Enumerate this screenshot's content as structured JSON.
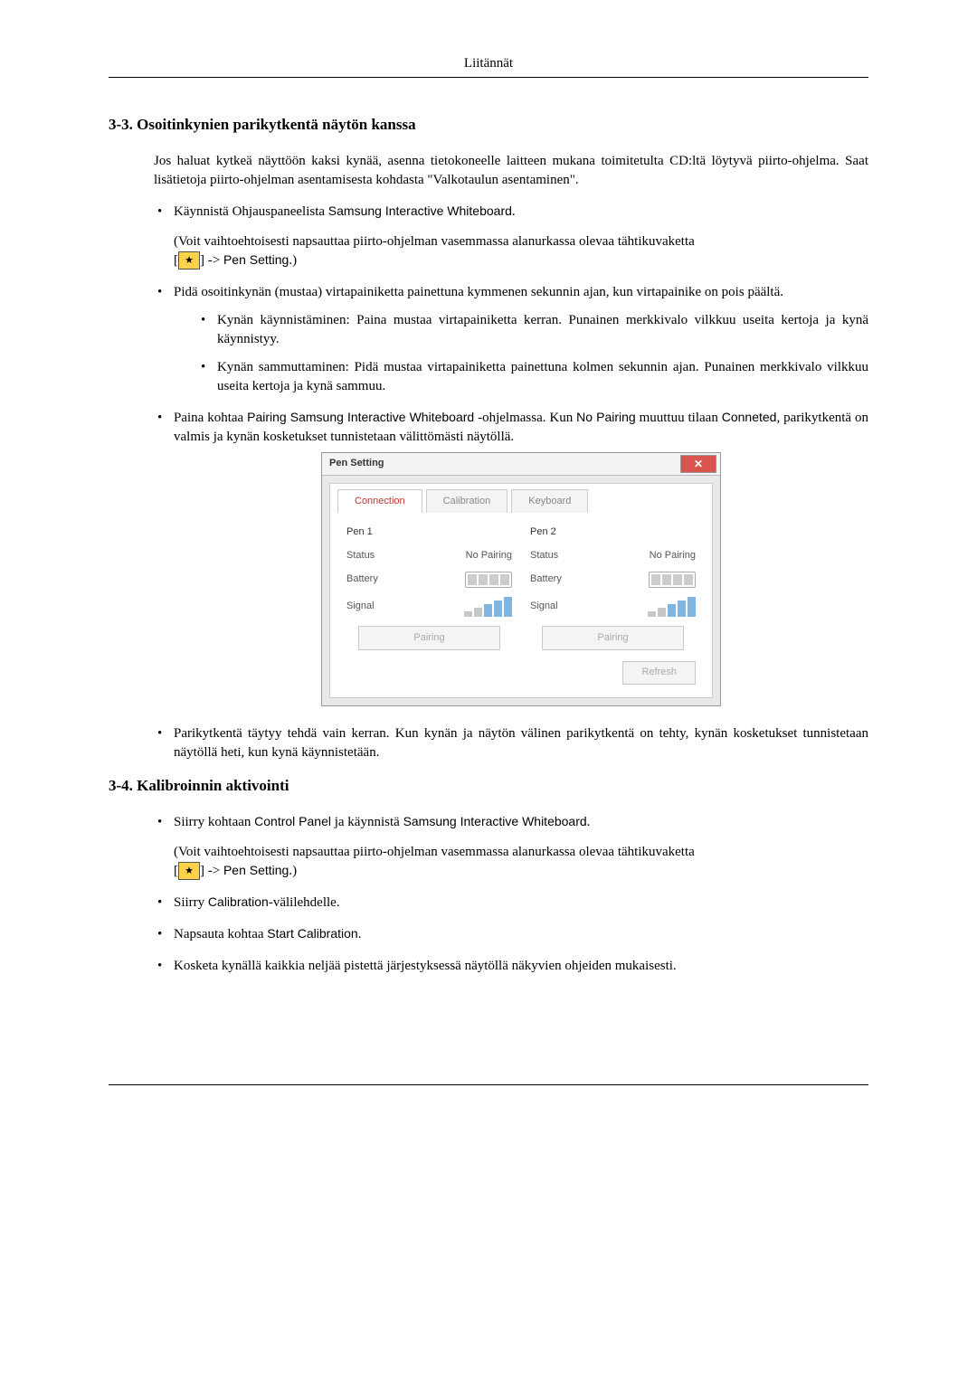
{
  "header": {
    "title": "Liitännät"
  },
  "section33": {
    "heading": "3-3. Osoitinkynien parikytkentä näytön kanssa",
    "intro": "Jos haluat kytkeä näyttöön kaksi kynää, asenna tietokoneelle laitteen mukana toimitetulta CD:ltä löytyvä piirto-ohjelma. Saat lisätietoja piirto-ohjelman asentamisesta kohdasta \"Valkotaulun asentaminen\".",
    "b1_pre": "Käynnistä Ohjauspaneelista ",
    "b1_sans": "Samsung Interactive Whiteboard",
    "b1_post": ".",
    "b1_alt_pre": "(Voit vaihtoehtoisesti napsauttaa piirto-ohjelman vasemmassa alanurkassa olevaa tähtikuvaketta",
    "b1_alt_arrow": "] -> ",
    "b1_alt_sans": "Pen Setting",
    "b1_alt_post": ".)",
    "b2": "Pidä osoitinkynän (mustaa) virtapainiketta painettuna kymmenen sekunnin ajan, kun virtapainike on pois päältä.",
    "b2s1": "Kynän käynnistäminen: Paina mustaa virtapainiketta kerran. Punainen merkkivalo vilkkuu useita kertoja ja kynä käynnistyy.",
    "b2s2": "Kynän sammuttaminen: Pidä mustaa virtapainiketta painettuna kolmen sekunnin ajan. Punainen merkkivalo vilkkuu useita kertoja ja kynä sammuu.",
    "b3_pre": "Paina kohtaa ",
    "b3_sans1": "Pairing Samsung Interactive Whiteboard",
    "b3_mid": " -ohjelmassa. Kun ",
    "b3_sans2": "No Pairing",
    "b3_mid2": " muuttuu tilaan ",
    "b3_sans3": "Conneted",
    "b3_post": ", parikytkentä on valmis ja kynän kosketukset tunnistetaan välittömästi näytöllä.",
    "b4": "Parikytkentä täytyy tehdä vain kerran. Kun kynän ja näytön välinen parikytkentä on tehty, kynän kosketukset tunnistetaan näytöllä heti, kun kynä käynnistetään."
  },
  "dialog": {
    "title": "Pen Setting",
    "tabs": {
      "connection": "Connection",
      "calibration": "Calibration",
      "keyboard": "Keyboard"
    },
    "pen1": "Pen 1",
    "pen2": "Pen 2",
    "statusLabel": "Status",
    "statusValue": "No Pairing",
    "batteryLabel": "Battery",
    "signalLabel": "Signal",
    "pairingBtn": "Pairing",
    "refreshBtn": "Refresh",
    "close": "✕"
  },
  "section34": {
    "heading": "3-4. Kalibroinnin aktivointi",
    "b1_pre": "Siirry kohtaan ",
    "b1_sans1": "Control Panel",
    "b1_mid": " ja käynnistä ",
    "b1_sans2": "Samsung Interactive Whiteboard",
    "b1_post": ".",
    "b1_alt_pre": "(Voit vaihtoehtoisesti napsauttaa piirto-ohjelman vasemmassa alanurkassa olevaa tähtikuvaketta",
    "b1_alt_arrow": "] -> ",
    "b1_alt_sans": "Pen Setting",
    "b1_alt_post": ".)",
    "b2_pre": "Siirry ",
    "b2_sans": "Calibration",
    "b2_post": "-välilehdelle.",
    "b3_pre": "Napsauta kohtaa ",
    "b3_sans": "Start Calibration",
    "b3_post": ".",
    "b4": "Kosketa kynällä kaikkia neljää pistettä järjestyksessä näytöllä näkyvien ohjeiden mukaisesti."
  }
}
